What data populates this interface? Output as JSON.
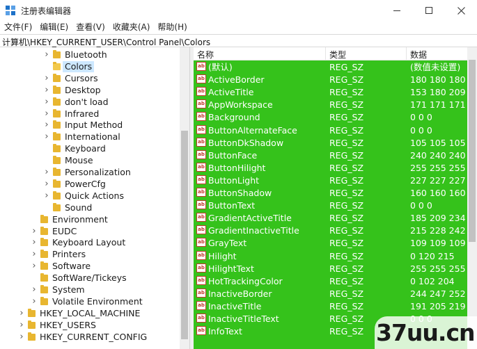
{
  "window": {
    "title": "注册表编辑器",
    "controls": {
      "minimize": "minimize-icon",
      "maximize": "maximize-icon",
      "close": "close-icon"
    }
  },
  "menu": [
    "文件(F)",
    "编辑(E)",
    "查看(V)",
    "收藏夹(A)",
    "帮助(H)"
  ],
  "address": "计算机\\HKEY_CURRENT_USER\\Control Panel\\Colors",
  "tree": [
    {
      "label": "Bluetooth",
      "expandable": true
    },
    {
      "label": "Colors",
      "expandable": false,
      "selected": true
    },
    {
      "label": "Cursors",
      "expandable": true
    },
    {
      "label": "Desktop",
      "expandable": true
    },
    {
      "label": "don't load",
      "expandable": true
    },
    {
      "label": "Infrared",
      "expandable": true
    },
    {
      "label": "Input Method",
      "expandable": true
    },
    {
      "label": "International",
      "expandable": true
    },
    {
      "label": "Keyboard",
      "expandable": false
    },
    {
      "label": "Mouse",
      "expandable": false
    },
    {
      "label": "Personalization",
      "expandable": true
    },
    {
      "label": "PowerCfg",
      "expandable": true
    },
    {
      "label": "Quick Actions",
      "expandable": true
    },
    {
      "label": "Sound",
      "expandable": false
    },
    {
      "label": "Environment",
      "expandable": false
    },
    {
      "label": "EUDC",
      "expandable": true
    },
    {
      "label": "Keyboard Layout",
      "expandable": true
    },
    {
      "label": "Printers",
      "expandable": true
    },
    {
      "label": "Software",
      "expandable": true
    },
    {
      "label": "SoftWare/Tickeys",
      "expandable": false
    },
    {
      "label": "System",
      "expandable": true
    },
    {
      "label": "Volatile Environment",
      "expandable": true
    },
    {
      "label": "HKEY_LOCAL_MACHINE",
      "expandable": true
    },
    {
      "label": "HKEY_USERS",
      "expandable": true
    },
    {
      "label": "HKEY_CURRENT_CONFIG",
      "expandable": true
    }
  ],
  "columns": {
    "name": "名称",
    "type": "类型",
    "data": "数据"
  },
  "values": [
    {
      "name": "(默认)",
      "type": "REG_SZ",
      "data": "(数值未设置)"
    },
    {
      "name": "ActiveBorder",
      "type": "REG_SZ",
      "data": "180 180 180"
    },
    {
      "name": "ActiveTitle",
      "type": "REG_SZ",
      "data": "153 180 209"
    },
    {
      "name": "AppWorkspace",
      "type": "REG_SZ",
      "data": "171 171 171"
    },
    {
      "name": "Background",
      "type": "REG_SZ",
      "data": "0 0 0"
    },
    {
      "name": "ButtonAlternateFace",
      "type": "REG_SZ",
      "data": "0 0 0"
    },
    {
      "name": "ButtonDkShadow",
      "type": "REG_SZ",
      "data": "105 105 105"
    },
    {
      "name": "ButtonFace",
      "type": "REG_SZ",
      "data": "240 240 240"
    },
    {
      "name": "ButtonHilight",
      "type": "REG_SZ",
      "data": "255 255 255"
    },
    {
      "name": "ButtonLight",
      "type": "REG_SZ",
      "data": "227 227 227"
    },
    {
      "name": "ButtonShadow",
      "type": "REG_SZ",
      "data": "160 160 160"
    },
    {
      "name": "ButtonText",
      "type": "REG_SZ",
      "data": "0 0 0"
    },
    {
      "name": "GradientActiveTitle",
      "type": "REG_SZ",
      "data": "185 209 234"
    },
    {
      "name": "GradientInactiveTitle",
      "type": "REG_SZ",
      "data": "215 228 242"
    },
    {
      "name": "GrayText",
      "type": "REG_SZ",
      "data": "109 109 109"
    },
    {
      "name": "Hilight",
      "type": "REG_SZ",
      "data": "0 120 215"
    },
    {
      "name": "HilightText",
      "type": "REG_SZ",
      "data": "255 255 255"
    },
    {
      "name": "HotTrackingColor",
      "type": "REG_SZ",
      "data": "0 102 204"
    },
    {
      "name": "InactiveBorder",
      "type": "REG_SZ",
      "data": "244 247 252"
    },
    {
      "name": "InactiveTitle",
      "type": "REG_SZ",
      "data": "191 205 219"
    },
    {
      "name": "InactiveTitleText",
      "type": "REG_SZ",
      "data": "0 0 0"
    },
    {
      "name": "InfoText",
      "type": "REG_SZ",
      "data": ""
    }
  ],
  "value_icon": {
    "name": "string-value-icon",
    "text": "ab"
  },
  "colors": {
    "list_background": "#35c21b",
    "selection": "#cde8ff",
    "folder": "#e8b630"
  },
  "watermark": "37uu.cn"
}
